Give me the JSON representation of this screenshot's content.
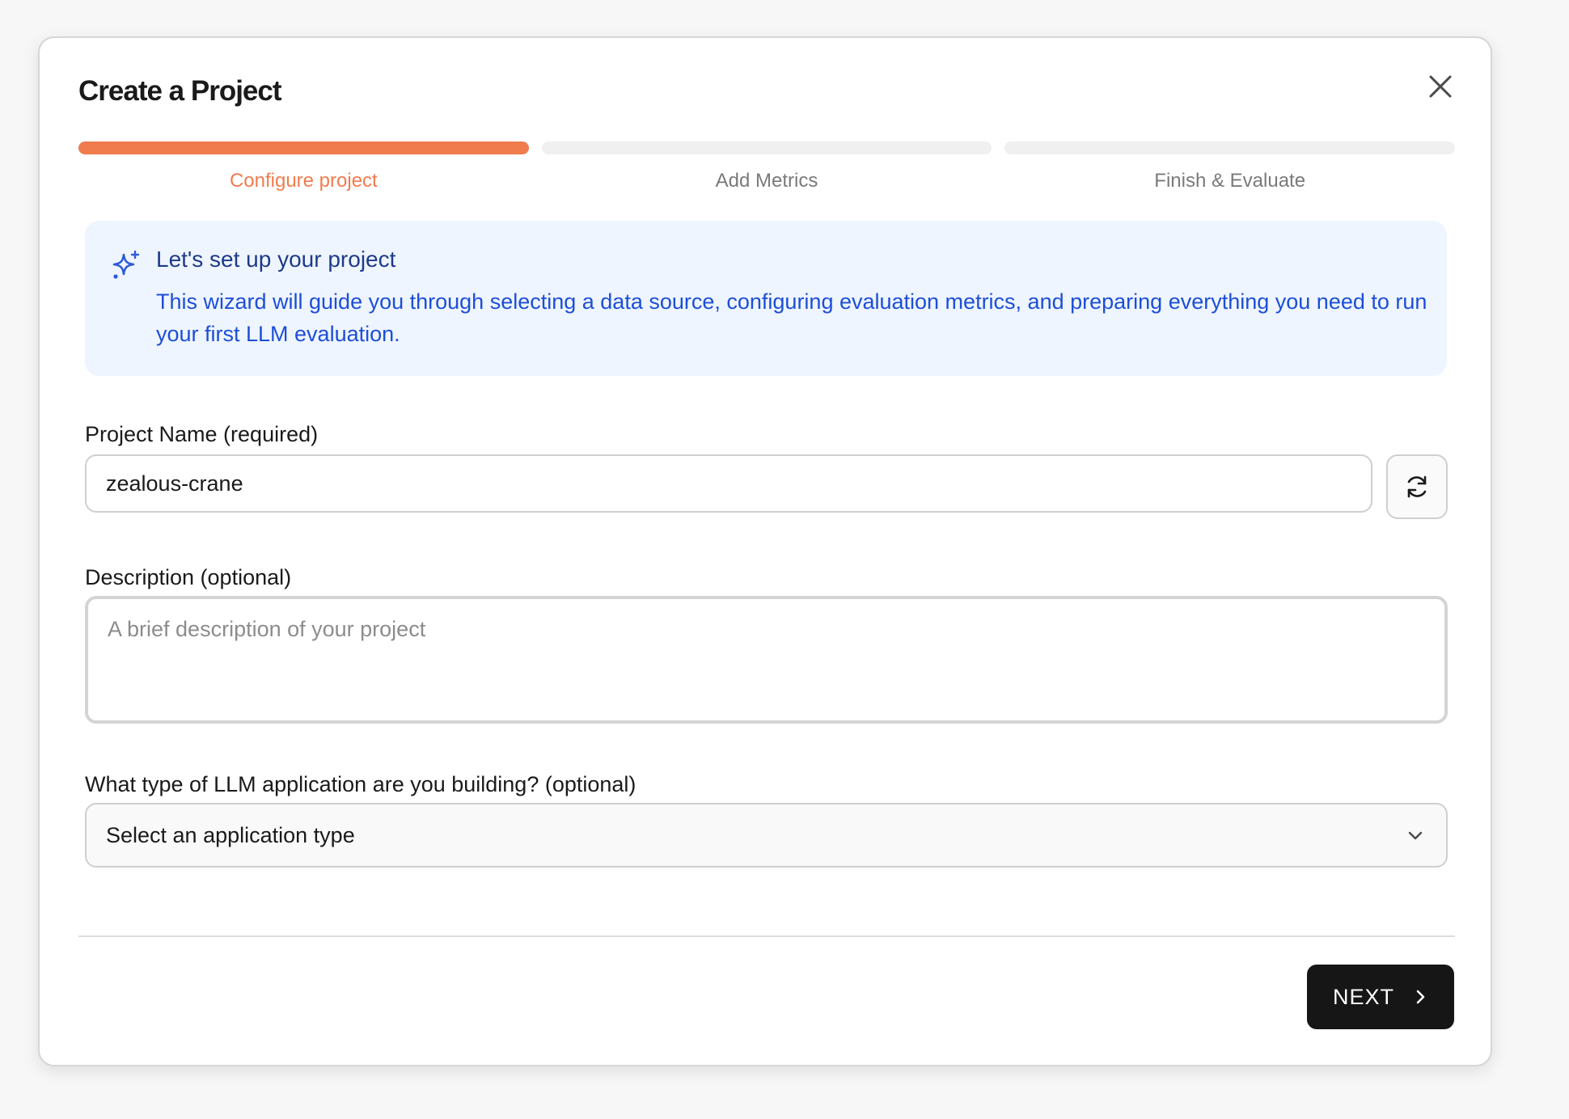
{
  "modal": {
    "title": "Create a Project",
    "close_icon": "close-icon"
  },
  "steps": [
    {
      "label": "Configure project",
      "active": true
    },
    {
      "label": "Add Metrics",
      "active": false
    },
    {
      "label": "Finish & Evaluate",
      "active": false
    }
  ],
  "info": {
    "icon": "sparkles-icon",
    "title": "Let's set up your project",
    "body": "This wizard will guide you through selecting a data source, configuring evaluation metrics, and preparing everything you need to run your first LLM evaluation."
  },
  "project_name": {
    "label": "Project Name (required)",
    "value": "zealous-crane",
    "refresh_icon": "refresh-icon"
  },
  "description": {
    "label": "Description (optional)",
    "placeholder": "A brief description of your project",
    "value": ""
  },
  "app_type": {
    "label": "What type of LLM application are you building? (optional)",
    "selected": "Select an application type",
    "chevron_icon": "chevron-down-icon"
  },
  "footer": {
    "next_label": "NEXT",
    "next_icon": "chevron-right-icon"
  },
  "colors": {
    "accent": "#f07c4e",
    "info_bg": "#eef5fe",
    "info_text": "#1d4ed8",
    "primary_button": "#161616"
  }
}
